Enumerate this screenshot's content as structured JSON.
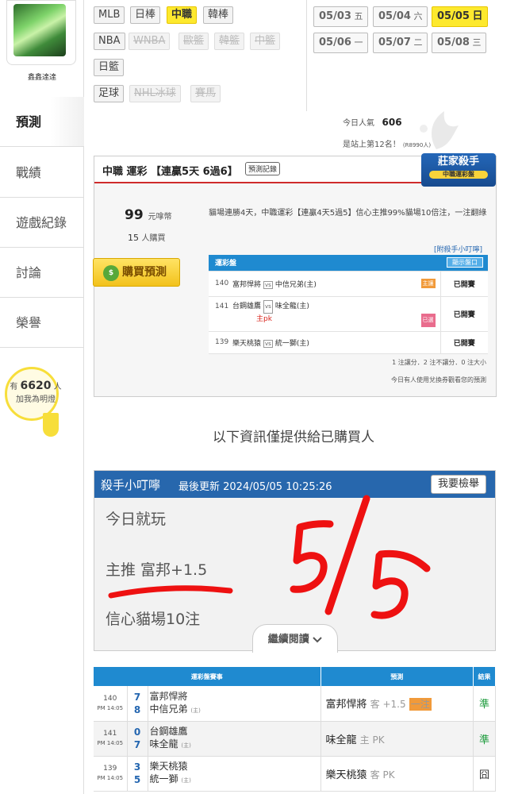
{
  "user": {
    "name": "鑫鑫達達"
  },
  "nav": [
    {
      "label": "預測",
      "active": true
    },
    {
      "label": "戰績"
    },
    {
      "label": "遊戲紀錄"
    },
    {
      "label": "討論"
    },
    {
      "label": "榮譽"
    }
  ],
  "bulb": {
    "prefix": "有",
    "count": "6620",
    "suffix": "人",
    "caption": "加我為明燈"
  },
  "leagues": {
    "row1": [
      "MLB",
      "日棒",
      "中職",
      "韓棒"
    ],
    "row2": [
      "NBA",
      "WNBA",
      "歐籃",
      "韓籃",
      "中籃"
    ],
    "row3": [
      "日籃"
    ],
    "row4": [
      "足球",
      "NHL冰球",
      "賽馬"
    ],
    "active": "中職"
  },
  "dates": [
    {
      "md": "05/03",
      "wd": "五"
    },
    {
      "md": "05/04",
      "wd": "六"
    },
    {
      "md": "05/05",
      "wd": "日",
      "active": true
    },
    {
      "md": "05/06",
      "wd": "一"
    },
    {
      "md": "05/07",
      "wd": "二"
    },
    {
      "md": "05/08",
      "wd": "三"
    }
  ],
  "popularity": {
    "label": "今日人氣",
    "value": "606",
    "rank": "是站上第12名！",
    "rank_note": "(R8990人)"
  },
  "card": {
    "title": "中職 運彩 【連贏5天 6過6】",
    "record_btn": "預測記錄",
    "badge": "莊家殺手",
    "badge_sub": "中職運彩盤",
    "price": "99",
    "price_unit": "元嗱幣",
    "buyers": "15",
    "buyers_unit": "人購買",
    "desc": "貓場連勝4天，中職運彩【連贏4天5過5】信心主推99%貓場10倍注，一注翻綠",
    "buy_btn": "購買預測",
    "link": "[附殺手小叮嚀]",
    "table_title": "運彩盤",
    "show_btn": "顯示盤口",
    "games": [
      {
        "no": "140",
        "away": "富邦悍將",
        "home": "中信兄弟(主)",
        "flag": "主讓",
        "status": "已開賽"
      },
      {
        "no": "141",
        "away": "台鋼雄鷹",
        "home": "味全龍(主)",
        "note": "主pk",
        "flag": "已選",
        "status": "已開賽"
      },
      {
        "no": "139",
        "away": "樂天桃猿",
        "home": "統一獅(主)",
        "status": "已開賽"
      }
    ],
    "summary": "1 注讓分．2 注不讓分．0 注大小",
    "exchange": "今日有人使用兌換券觀看您的預測"
  },
  "info": "以下資訊僅提供給已購買人",
  "tip": {
    "name": "殺手小叮嚀",
    "updated": "最後更新 2024/05/05 10:25:26",
    "report": "我要檢舉",
    "line1": "今日就玩",
    "line2": "主推 富邦+1.5",
    "line3": "信心貓場10注",
    "more": "繼續閱讀"
  },
  "results": {
    "headers": [
      "運彩盤賽事",
      "預測",
      "結果"
    ],
    "rows": [
      {
        "no": "140",
        "time": "PM 14:05",
        "s1": "7",
        "s2": "8",
        "t1": "富邦悍將",
        "t2": "中信兄弟",
        "home": "(主)",
        "pick": "富邦悍將",
        "pick_note": "客 +1.5",
        "badge": "一注",
        "result": "準"
      },
      {
        "no": "141",
        "time": "PM 14:05",
        "s1": "0",
        "s2": "7",
        "t1": "台鋼雄鷹",
        "t2": "味全龍",
        "home": "(主)",
        "pick": "味全龍",
        "pick_note": "主 PK",
        "result": "準"
      },
      {
        "no": "139",
        "time": "PM 14:05",
        "s1": "3",
        "s2": "5",
        "t1": "樂天桃猿",
        "t2": "統一獅",
        "home": "(主)",
        "pick": "樂天桃猿",
        "pick_note": "客 PK",
        "result": "囧"
      }
    ]
  },
  "handwriting": "5/5"
}
